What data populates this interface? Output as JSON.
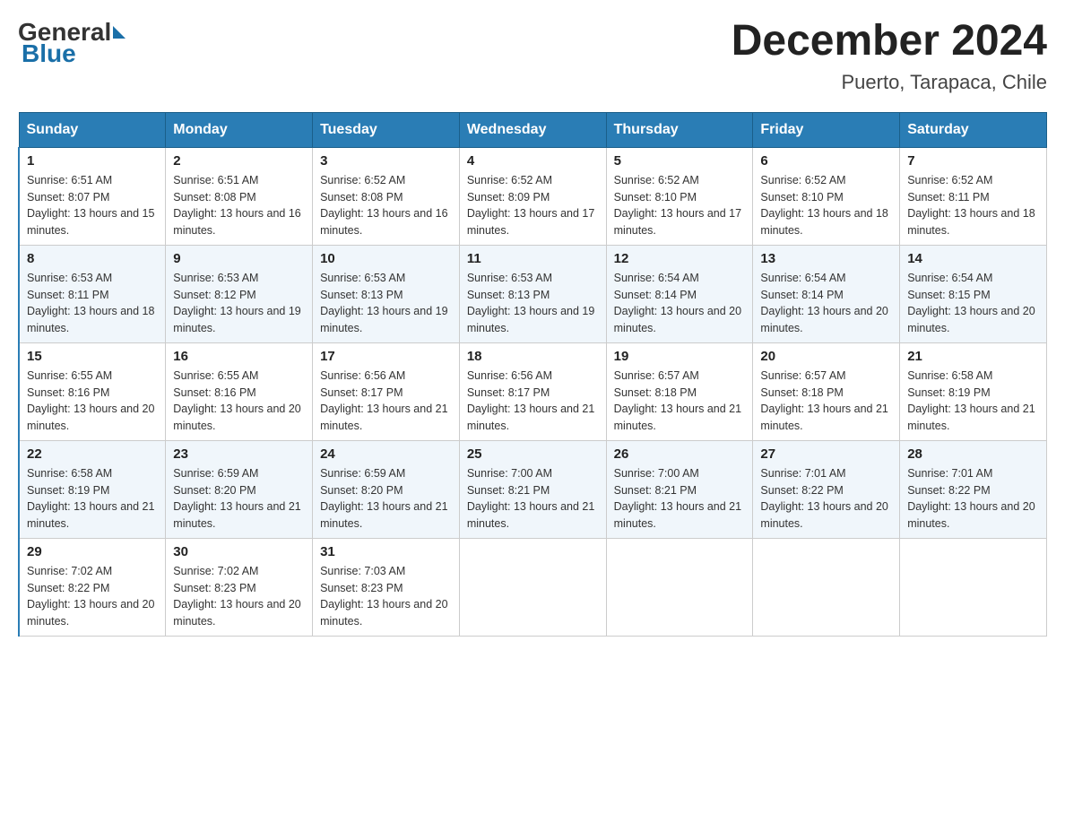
{
  "header": {
    "logo": {
      "general": "General",
      "blue": "Blue"
    },
    "title": "December 2024",
    "location": "Puerto, Tarapaca, Chile"
  },
  "columns": [
    "Sunday",
    "Monday",
    "Tuesday",
    "Wednesday",
    "Thursday",
    "Friday",
    "Saturday"
  ],
  "weeks": [
    [
      {
        "day": "1",
        "sunrise": "Sunrise: 6:51 AM",
        "sunset": "Sunset: 8:07 PM",
        "daylight": "Daylight: 13 hours and 15 minutes."
      },
      {
        "day": "2",
        "sunrise": "Sunrise: 6:51 AM",
        "sunset": "Sunset: 8:08 PM",
        "daylight": "Daylight: 13 hours and 16 minutes."
      },
      {
        "day": "3",
        "sunrise": "Sunrise: 6:52 AM",
        "sunset": "Sunset: 8:08 PM",
        "daylight": "Daylight: 13 hours and 16 minutes."
      },
      {
        "day": "4",
        "sunrise": "Sunrise: 6:52 AM",
        "sunset": "Sunset: 8:09 PM",
        "daylight": "Daylight: 13 hours and 17 minutes."
      },
      {
        "day": "5",
        "sunrise": "Sunrise: 6:52 AM",
        "sunset": "Sunset: 8:10 PM",
        "daylight": "Daylight: 13 hours and 17 minutes."
      },
      {
        "day": "6",
        "sunrise": "Sunrise: 6:52 AM",
        "sunset": "Sunset: 8:10 PM",
        "daylight": "Daylight: 13 hours and 18 minutes."
      },
      {
        "day": "7",
        "sunrise": "Sunrise: 6:52 AM",
        "sunset": "Sunset: 8:11 PM",
        "daylight": "Daylight: 13 hours and 18 minutes."
      }
    ],
    [
      {
        "day": "8",
        "sunrise": "Sunrise: 6:53 AM",
        "sunset": "Sunset: 8:11 PM",
        "daylight": "Daylight: 13 hours and 18 minutes."
      },
      {
        "day": "9",
        "sunrise": "Sunrise: 6:53 AM",
        "sunset": "Sunset: 8:12 PM",
        "daylight": "Daylight: 13 hours and 19 minutes."
      },
      {
        "day": "10",
        "sunrise": "Sunrise: 6:53 AM",
        "sunset": "Sunset: 8:13 PM",
        "daylight": "Daylight: 13 hours and 19 minutes."
      },
      {
        "day": "11",
        "sunrise": "Sunrise: 6:53 AM",
        "sunset": "Sunset: 8:13 PM",
        "daylight": "Daylight: 13 hours and 19 minutes."
      },
      {
        "day": "12",
        "sunrise": "Sunrise: 6:54 AM",
        "sunset": "Sunset: 8:14 PM",
        "daylight": "Daylight: 13 hours and 20 minutes."
      },
      {
        "day": "13",
        "sunrise": "Sunrise: 6:54 AM",
        "sunset": "Sunset: 8:14 PM",
        "daylight": "Daylight: 13 hours and 20 minutes."
      },
      {
        "day": "14",
        "sunrise": "Sunrise: 6:54 AM",
        "sunset": "Sunset: 8:15 PM",
        "daylight": "Daylight: 13 hours and 20 minutes."
      }
    ],
    [
      {
        "day": "15",
        "sunrise": "Sunrise: 6:55 AM",
        "sunset": "Sunset: 8:16 PM",
        "daylight": "Daylight: 13 hours and 20 minutes."
      },
      {
        "day": "16",
        "sunrise": "Sunrise: 6:55 AM",
        "sunset": "Sunset: 8:16 PM",
        "daylight": "Daylight: 13 hours and 20 minutes."
      },
      {
        "day": "17",
        "sunrise": "Sunrise: 6:56 AM",
        "sunset": "Sunset: 8:17 PM",
        "daylight": "Daylight: 13 hours and 21 minutes."
      },
      {
        "day": "18",
        "sunrise": "Sunrise: 6:56 AM",
        "sunset": "Sunset: 8:17 PM",
        "daylight": "Daylight: 13 hours and 21 minutes."
      },
      {
        "day": "19",
        "sunrise": "Sunrise: 6:57 AM",
        "sunset": "Sunset: 8:18 PM",
        "daylight": "Daylight: 13 hours and 21 minutes."
      },
      {
        "day": "20",
        "sunrise": "Sunrise: 6:57 AM",
        "sunset": "Sunset: 8:18 PM",
        "daylight": "Daylight: 13 hours and 21 minutes."
      },
      {
        "day": "21",
        "sunrise": "Sunrise: 6:58 AM",
        "sunset": "Sunset: 8:19 PM",
        "daylight": "Daylight: 13 hours and 21 minutes."
      }
    ],
    [
      {
        "day": "22",
        "sunrise": "Sunrise: 6:58 AM",
        "sunset": "Sunset: 8:19 PM",
        "daylight": "Daylight: 13 hours and 21 minutes."
      },
      {
        "day": "23",
        "sunrise": "Sunrise: 6:59 AM",
        "sunset": "Sunset: 8:20 PM",
        "daylight": "Daylight: 13 hours and 21 minutes."
      },
      {
        "day": "24",
        "sunrise": "Sunrise: 6:59 AM",
        "sunset": "Sunset: 8:20 PM",
        "daylight": "Daylight: 13 hours and 21 minutes."
      },
      {
        "day": "25",
        "sunrise": "Sunrise: 7:00 AM",
        "sunset": "Sunset: 8:21 PM",
        "daylight": "Daylight: 13 hours and 21 minutes."
      },
      {
        "day": "26",
        "sunrise": "Sunrise: 7:00 AM",
        "sunset": "Sunset: 8:21 PM",
        "daylight": "Daylight: 13 hours and 21 minutes."
      },
      {
        "day": "27",
        "sunrise": "Sunrise: 7:01 AM",
        "sunset": "Sunset: 8:22 PM",
        "daylight": "Daylight: 13 hours and 20 minutes."
      },
      {
        "day": "28",
        "sunrise": "Sunrise: 7:01 AM",
        "sunset": "Sunset: 8:22 PM",
        "daylight": "Daylight: 13 hours and 20 minutes."
      }
    ],
    [
      {
        "day": "29",
        "sunrise": "Sunrise: 7:02 AM",
        "sunset": "Sunset: 8:22 PM",
        "daylight": "Daylight: 13 hours and 20 minutes."
      },
      {
        "day": "30",
        "sunrise": "Sunrise: 7:02 AM",
        "sunset": "Sunset: 8:23 PM",
        "daylight": "Daylight: 13 hours and 20 minutes."
      },
      {
        "day": "31",
        "sunrise": "Sunrise: 7:03 AM",
        "sunset": "Sunset: 8:23 PM",
        "daylight": "Daylight: 13 hours and 20 minutes."
      },
      null,
      null,
      null,
      null
    ]
  ]
}
